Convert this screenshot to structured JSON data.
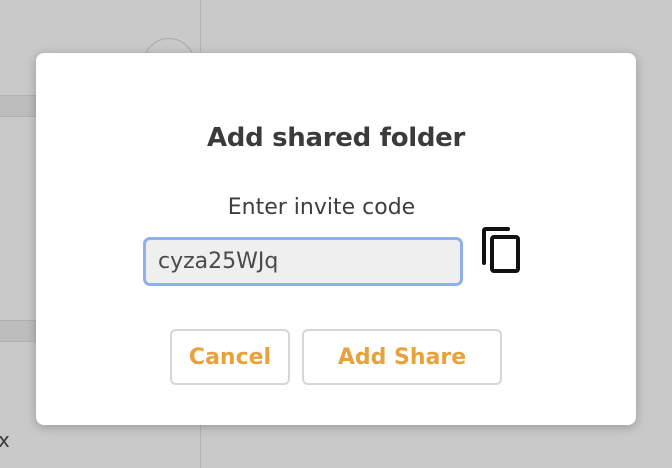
{
  "background": {
    "close_glyph": "x"
  },
  "dialog": {
    "title": "Add shared folder",
    "prompt": "Enter invite code",
    "invite_code_value": "cyza25WJq",
    "copy_icon": "copy-icon",
    "cancel_label": "Cancel",
    "add_label": "Add Share"
  },
  "colors": {
    "accent": "#e8a23c",
    "input_focus_border": "#8fb0ee",
    "overlay": "#c9c9c9"
  }
}
